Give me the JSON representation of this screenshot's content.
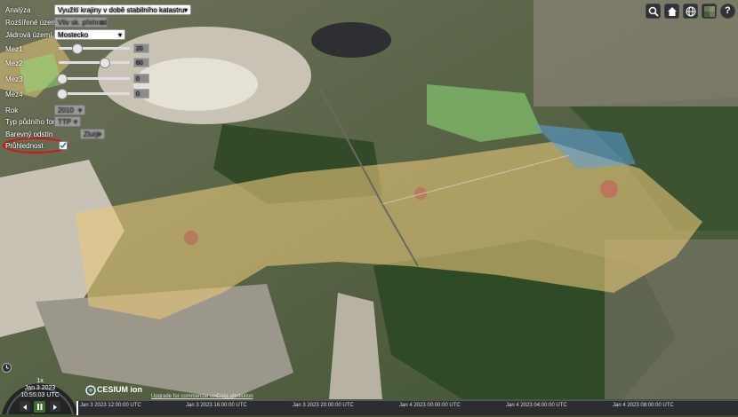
{
  "panel": {
    "analysis_label": "Analýza",
    "analysis_value": "Využití krajiny v době stabilního katastru",
    "extended_area_label": "Rozšířené území",
    "extended_area_value": "Vliv sk. přehrada",
    "core_area_label": "Jádrová území",
    "core_area_value": "Mostecko",
    "sliders": [
      {
        "label": "Mez1",
        "value": "20"
      },
      {
        "label": "Mez2",
        "value": "60"
      },
      {
        "label": "Mez3",
        "value": "0"
      },
      {
        "label": "Mez4",
        "value": "0"
      }
    ],
    "year_label": "Rok",
    "year_value": "2010",
    "unit_type_label": "Typ půdního fondu",
    "unit_type_value": "TTP",
    "color_label": "Barevný odstín",
    "color_value": "Zlutý",
    "transparency_label": "Průhlednost",
    "transparency_checked": true
  },
  "toolbar": {
    "icons": [
      "search-icon",
      "home-icon",
      "globe-icon",
      "layers-icon",
      "help-icon"
    ],
    "help_label": "?"
  },
  "animation": {
    "speed": "1x",
    "date": "Jan 3 2023",
    "time": "10:55:03 UTC"
  },
  "credits": {
    "logo_text": "CESIUM ion",
    "upgrade_text": "Upgrade for commercial use.",
    "data_attribution": "Data attribution"
  },
  "timeline": {
    "ticks": [
      "Jan 3 2023 12:00:00 UTC",
      "Jan 3 2023 16:00:00 UTC",
      "Jan 3 2023 20:00:00 UTC",
      "Jan 4 2023 00:00:00 UTC",
      "Jan 4 2023 04:00:00 UTC",
      "Jan 4 2023 08:00:00 UTC"
    ]
  },
  "colors": {
    "highlight_ring": "#d01818",
    "overlay_yellow": "#e8c87a",
    "overlay_green": "#8fe07a",
    "overlay_blue": "#5aa0e0"
  }
}
